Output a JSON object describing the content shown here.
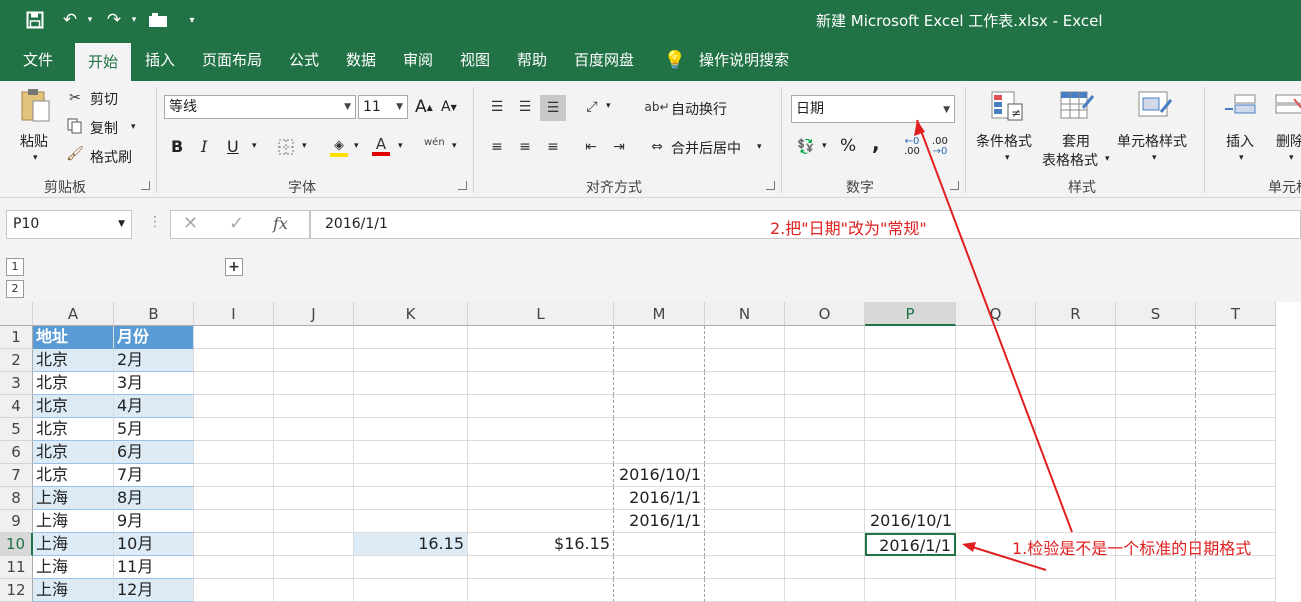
{
  "title": "新建 Microsoft Excel 工作表.xlsx  -  Excel",
  "qat": {
    "save_icon": "save-icon",
    "undo_icon": "undo-icon",
    "redo_icon": "redo-icon",
    "camera_icon": "camera-icon",
    "customize": "▾"
  },
  "tabs": [
    {
      "label": "文件"
    },
    {
      "label": "开始",
      "active": true
    },
    {
      "label": "插入"
    },
    {
      "label": "页面布局"
    },
    {
      "label": "公式"
    },
    {
      "label": "数据"
    },
    {
      "label": "审阅"
    },
    {
      "label": "视图"
    },
    {
      "label": "帮助"
    },
    {
      "label": "百度网盘"
    }
  ],
  "tell_me": "操作说明搜索",
  "clipboard": {
    "paste": "粘贴",
    "cut": "剪切",
    "copy": "复制",
    "format_painter": "格式刷",
    "label": "剪贴板"
  },
  "font": {
    "name": "等线",
    "size": "11",
    "bold": "B",
    "italic": "I",
    "underline": "U",
    "grow": "A",
    "shrink": "A",
    "phonetic": "wén",
    "label": "字体",
    "font_color": "#e00000",
    "fill_color": "#ffe000"
  },
  "alignment": {
    "wrap": "自动换行",
    "merge": "合并后居中",
    "label": "对齐方式"
  },
  "number": {
    "format": "日期",
    "percent": "%",
    "comma": ",",
    "inc_decimal": ".00",
    "dec_decimal": ".00",
    "label": "数字"
  },
  "styles": {
    "conditional": "条件格式",
    "table_line1": "套用",
    "table_line2": "表格格式",
    "cell_styles": "单元格样式",
    "label": "样式"
  },
  "cells": {
    "insert": "插入",
    "delete": "删除",
    "label": "单元格"
  },
  "namebox": "P10",
  "formula": "2016/1/1",
  "fx": "fx",
  "outline": {
    "level1": "1",
    "level2": "2",
    "expand": "+"
  },
  "columns": [
    "A",
    "B",
    "I",
    "J",
    "K",
    "L",
    "M",
    "N",
    "O",
    "P",
    "Q",
    "R",
    "S",
    "T"
  ],
  "rows": [
    "1",
    "2",
    "3",
    "4",
    "5",
    "6",
    "7",
    "8",
    "9",
    "10",
    "11",
    "12"
  ],
  "cells_data": {
    "A": [
      "地址",
      "北京",
      "北京",
      "北京",
      "北京",
      "北京",
      "北京",
      "上海",
      "上海",
      "上海",
      "上海",
      "上海"
    ],
    "B": [
      "月份",
      "2月",
      "3月",
      "4月",
      "5月",
      "6月",
      "7月",
      "8月",
      "9月",
      "10月",
      "11月",
      "12月"
    ],
    "K10": "16.15",
    "L10": "$16.15",
    "M7": "2016/10/1",
    "M8": "2016/1/1",
    "M9": "2016/1/1",
    "P9": "2016/10/1",
    "P10": "2016/1/1"
  },
  "annotations": {
    "step1": "1.检验是不是一个标准的日期格式",
    "step2": "2.把\"日期\"改为\"常规\""
  },
  "colors": {
    "excel_green": "#217346",
    "header_blue": "#5b9bd5",
    "band_blue": "#ddebf7",
    "annotation_red": "#e02020"
  }
}
